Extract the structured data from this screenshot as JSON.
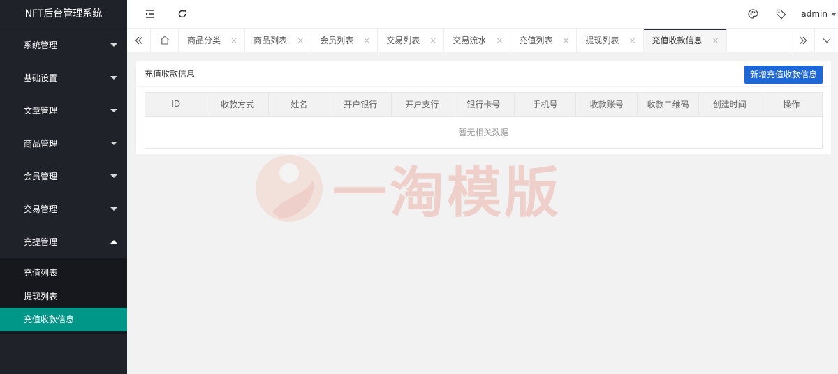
{
  "sidebar": {
    "logo": "NFT后台管理系统",
    "items": [
      {
        "label": "系统管理"
      },
      {
        "label": "基础设置"
      },
      {
        "label": "文章管理"
      },
      {
        "label": "商品管理"
      },
      {
        "label": "会员管理"
      },
      {
        "label": "交易管理"
      },
      {
        "label": "充提管理"
      }
    ],
    "submenu": [
      {
        "label": "充值列表"
      },
      {
        "label": "提现列表"
      },
      {
        "label": "充值收款信息"
      }
    ]
  },
  "header": {
    "user": "admin",
    "icons": [
      "menu-fold-icon",
      "refresh-icon",
      "theme-palette-icon",
      "tag-icon"
    ]
  },
  "tabs": [
    {
      "label": "商品分类"
    },
    {
      "label": "商品列表"
    },
    {
      "label": "会员列表"
    },
    {
      "label": "交易列表"
    },
    {
      "label": "交易流水"
    },
    {
      "label": "充值列表"
    },
    {
      "label": "提现列表"
    },
    {
      "label": "充值收款信息"
    }
  ],
  "tab_close": "×",
  "main": {
    "title": "充值收款信息",
    "add_button": "新增充值收款信息",
    "columns": [
      "ID",
      "收款方式",
      "姓名",
      "开户银行",
      "开户支行",
      "银行卡号",
      "手机号",
      "收款账号",
      "收款二维码",
      "创建时间",
      "操作"
    ],
    "empty_text": "暂无相关数据"
  },
  "watermark": "一淘模版",
  "colors": {
    "sidebar_bg": "#20222a",
    "active": "#009688",
    "primary_button": "#1e67d8"
  }
}
